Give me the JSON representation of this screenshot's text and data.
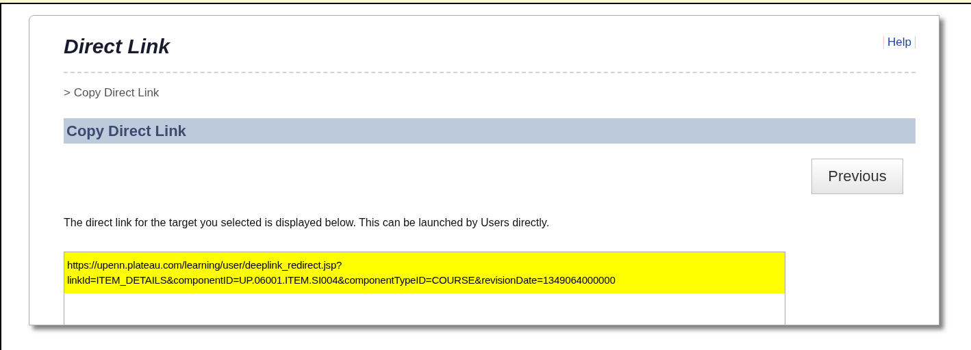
{
  "page": {
    "title": "Direct Link",
    "help_link": "Help"
  },
  "breadcrumb": "> Copy Direct Link",
  "section": {
    "title": "Copy Direct Link"
  },
  "buttons": [
    {
      "label": "Previous"
    }
  ],
  "description": "The direct link for the target you selected is displayed below. This can be launched by Users directly.",
  "link_field": {
    "value_lines": [
      "https://upenn.plateau.com/learning/user/deeplink_redirect.jsp?",
      "linkId=ITEM_DETAILS&componentID=UP.06001.ITEM.SI004&componentTypeID=COURSE&revisionDate=1349064000000"
    ],
    "selected": true
  }
}
